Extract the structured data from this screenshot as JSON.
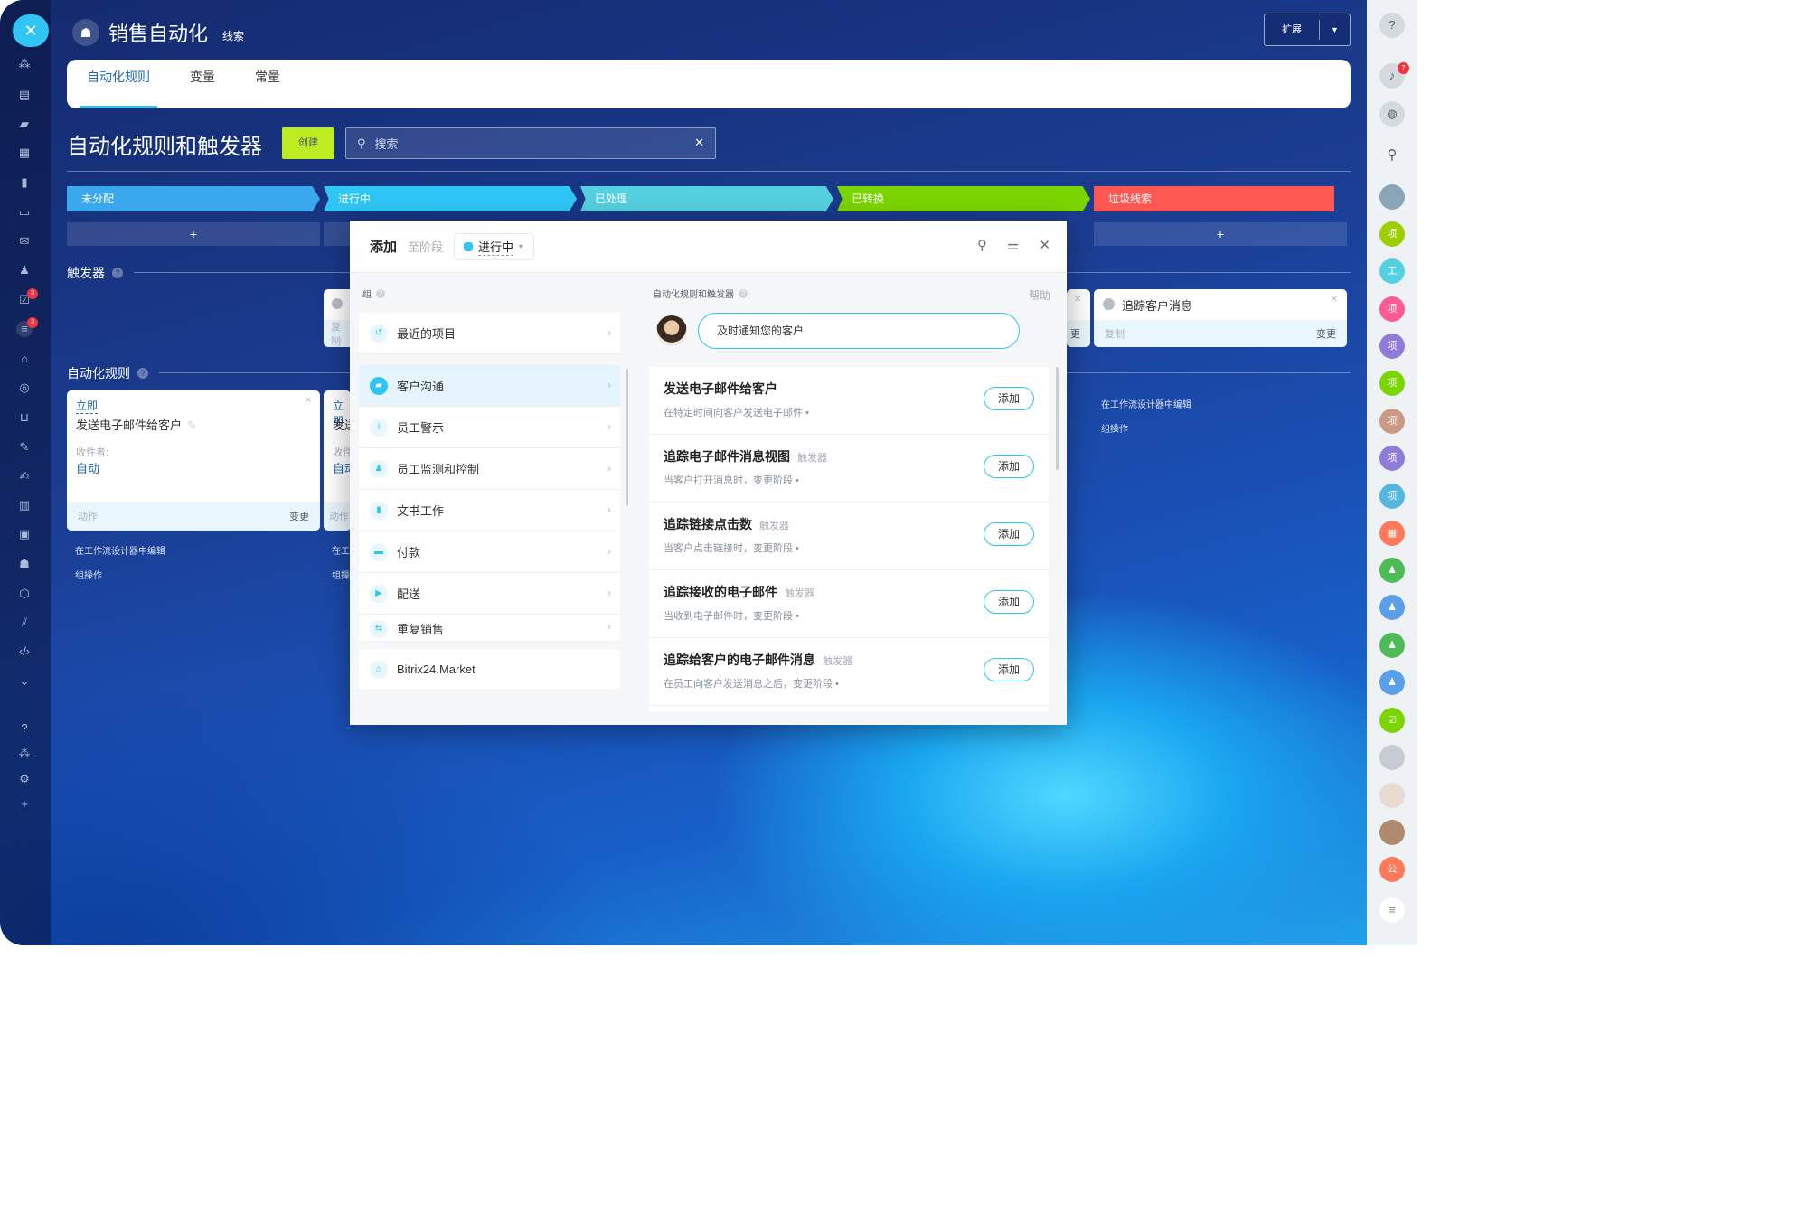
{
  "app": {
    "title": "销售自动化",
    "subtitle": "线索",
    "expand_button": "扩展"
  },
  "tabs": [
    {
      "label": "自动化规则"
    },
    {
      "label": "变量"
    },
    {
      "label": "常量"
    }
  ],
  "page": {
    "heading": "自动化规则和触发器",
    "create_button": "创建",
    "search_placeholder": "搜索"
  },
  "stages": [
    {
      "label": "未分配",
      "color": "#39a8ef"
    },
    {
      "label": "进行中",
      "color": "#2fc6f6"
    },
    {
      "label": "已处理",
      "color": "#55d0e0"
    },
    {
      "label": "已转换",
      "color": "#7bd500"
    },
    {
      "label": "垃圾线索",
      "color": "#ff5752"
    }
  ],
  "plus": "+",
  "sections": {
    "triggers": "触发器",
    "rules": "自动化规则"
  },
  "left_card": {
    "timing": "立即",
    "title": "发送电子邮件给客户",
    "recipient_label": "收件者:",
    "recipient_value": "自动",
    "footer_left": "动作",
    "footer_right": "变更",
    "link1": "在工作流设计器中编辑",
    "link2": "组操作"
  },
  "second_card": {
    "timing": "立即",
    "title": "发送",
    "recipient_label": "收件",
    "recipient_value": "自动",
    "footer_left": "动作",
    "link1": "在工",
    "link2": "组操"
  },
  "trigger_mini": {
    "title": "复制"
  },
  "right_trigger": {
    "title": "追踪客户消息",
    "footer_left": "复制",
    "footer_right": "变更",
    "partial_right": "更"
  },
  "right_links": {
    "link1": "在工作流设计器中编辑",
    "link2": "组操作"
  },
  "modal": {
    "title": "添加",
    "to_stage": "至阶段",
    "stage_selected": "进行中",
    "left_label": "组",
    "right_label": "自动化规则和触发器",
    "help": "帮助",
    "bot_message": "及时通知您的客户",
    "groups": [
      {
        "label": "最近的项目",
        "icon": "history-icon"
      },
      {
        "label": "客户沟通",
        "icon": "chat-icon",
        "selected": true
      },
      {
        "label": "员工警示",
        "icon": "info-icon"
      },
      {
        "label": "员工监测和控制",
        "icon": "users-icon"
      },
      {
        "label": "文书工作",
        "icon": "document-icon"
      },
      {
        "label": "付款",
        "icon": "wallet-icon"
      },
      {
        "label": "配送",
        "icon": "truck-icon"
      },
      {
        "label": "重复销售",
        "icon": "repeat-icon"
      }
    ],
    "market": "Bitrix24.Market",
    "items": [
      {
        "name": "发送电子邮件给客户",
        "tag": "",
        "desc": "在特定时间向客户发送电子邮件 •",
        "add": "添加"
      },
      {
        "name": "追踪电子邮件消息视图",
        "tag": "触发器",
        "desc": "当客户打开消息时，变更阶段 •",
        "add": "添加"
      },
      {
        "name": "追踪链接点击数",
        "tag": "触发器",
        "desc": "当客户点击链接时，变更阶段 •",
        "add": "添加"
      },
      {
        "name": "追踪接收的电子邮件",
        "tag": "触发器",
        "desc": "当收到电子邮件时，变更阶段 •",
        "add": "添加"
      },
      {
        "name": "追踪给客户的电子邮件消息",
        "tag": "触发器",
        "desc": "在员工向客户发送消息之后，变更阶段 •",
        "add": "添加"
      }
    ]
  },
  "left_badges": [
    "3",
    "3"
  ],
  "right_panel": {
    "notification_count": "7",
    "avatars": [
      {
        "label": "项",
        "color": "#9dcf00"
      },
      {
        "label": "工",
        "color": "#55d0e0"
      },
      {
        "label": "项",
        "color": "#ff5b93"
      },
      {
        "label": "项",
        "color": "#8e7cd8"
      },
      {
        "label": "项",
        "color": "#7bd500"
      },
      {
        "label": "项",
        "color": "#ca9a85"
      },
      {
        "label": "项",
        "color": "#8e7cd8"
      },
      {
        "label": "项",
        "color": "#55b7e0"
      },
      {
        "label": "公",
        "color": "#ff7a5a"
      }
    ]
  }
}
